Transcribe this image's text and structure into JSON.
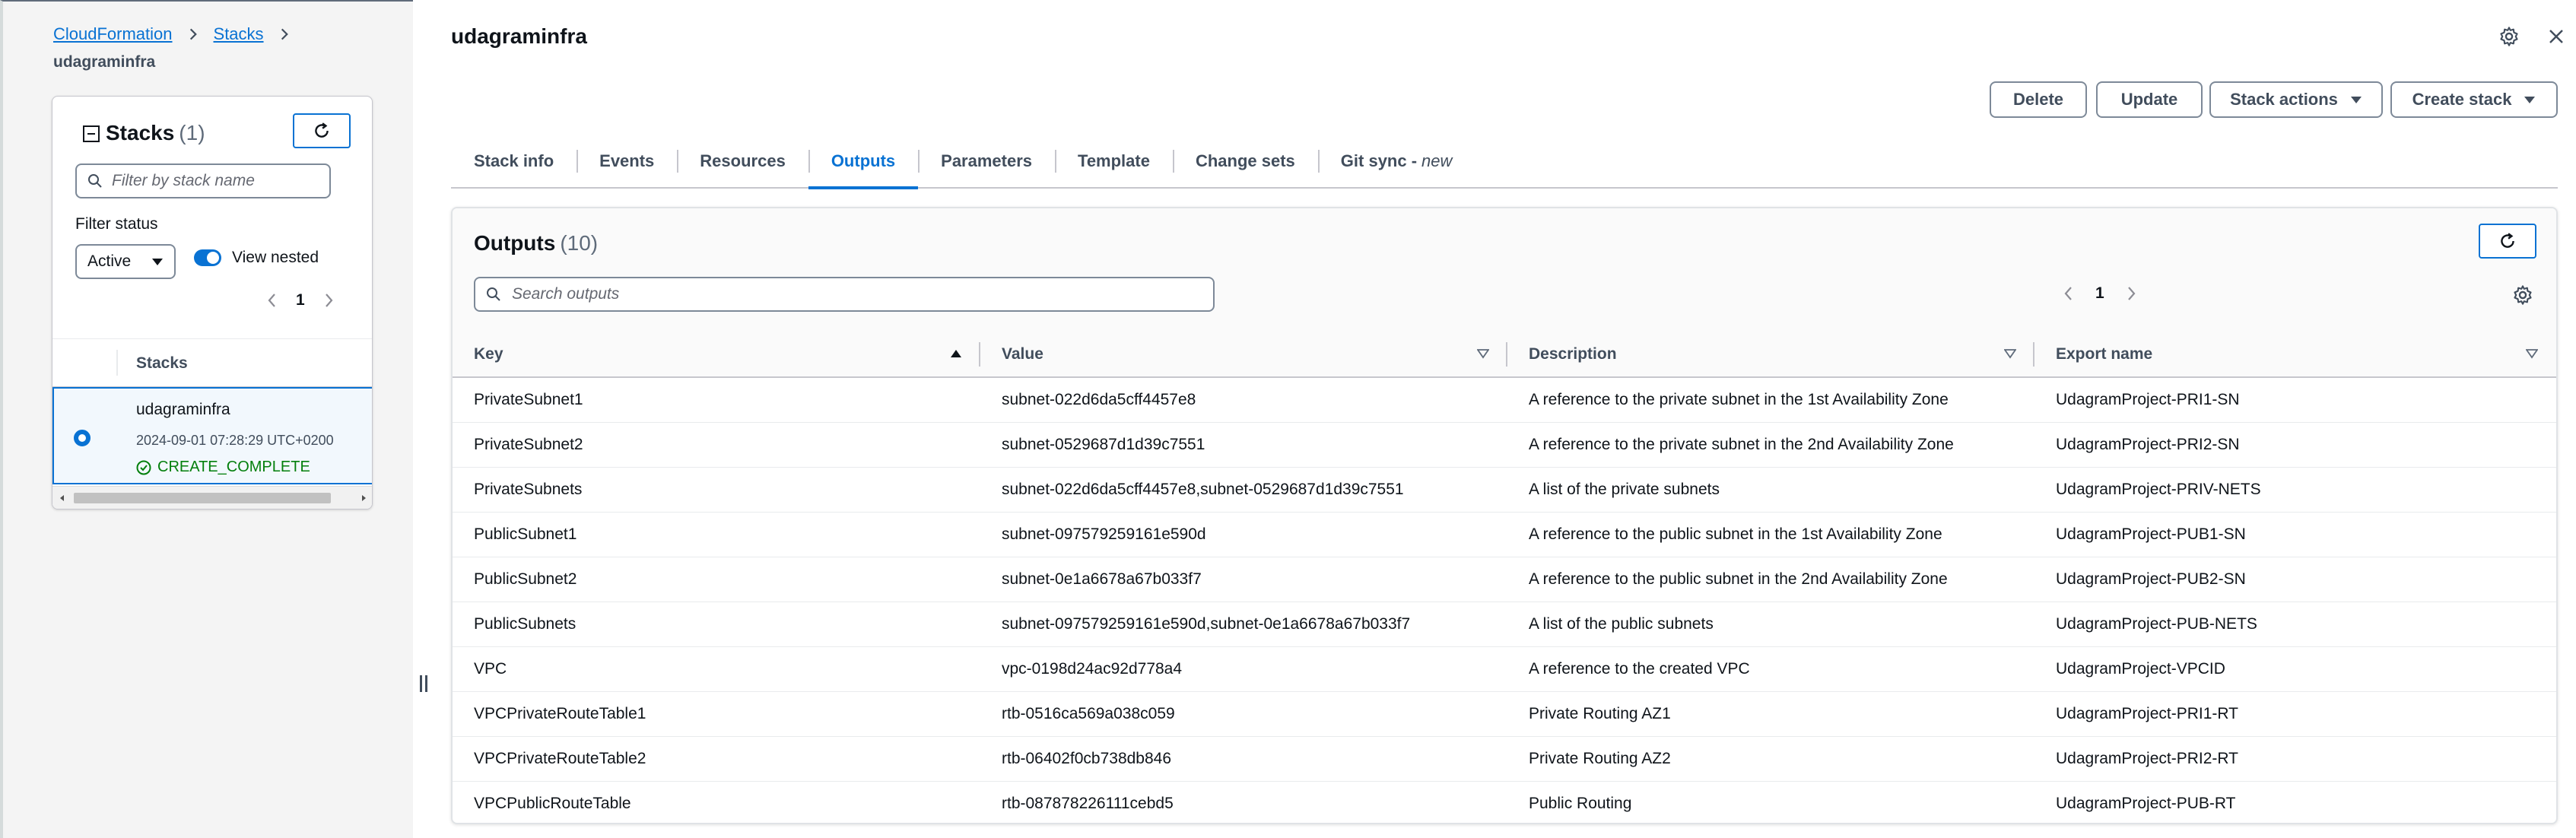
{
  "breadcrumb": {
    "items": [
      "CloudFormation",
      "Stacks"
    ],
    "current": "udagraminfra"
  },
  "stacks_panel": {
    "title": "Stacks",
    "count": "(1)",
    "filter_placeholder": "Filter by stack name",
    "filter_status_label": "Filter status",
    "status_value": "Active",
    "view_nested_label": "View nested",
    "page": "1",
    "column_header": "Stacks",
    "stack": {
      "name": "udagraminfra",
      "date": "2024-09-01 07:28:29 UTC+0200",
      "status": "CREATE_COMPLETE"
    }
  },
  "header": {
    "title": "udagraminfra",
    "buttons": {
      "delete": "Delete",
      "update": "Update",
      "stack_actions": "Stack actions",
      "create_stack": "Create stack"
    }
  },
  "tabs": [
    {
      "label": "Stack info"
    },
    {
      "label": "Events"
    },
    {
      "label": "Resources"
    },
    {
      "label": "Outputs",
      "active": true
    },
    {
      "label": "Parameters"
    },
    {
      "label": "Template"
    },
    {
      "label": "Change sets"
    },
    {
      "label": "Git sync - ",
      "suffix": "new"
    }
  ],
  "outputs": {
    "title": "Outputs",
    "count": "(10)",
    "search_placeholder": "Search outputs",
    "page": "1",
    "columns": [
      "Key",
      "Value",
      "Description",
      "Export name"
    ],
    "rows": [
      [
        "PrivateSubnet1",
        "subnet-022d6da5cff4457e8",
        "A reference to the private subnet in the 1st Availability Zone",
        "UdagramProject-PRI1-SN"
      ],
      [
        "PrivateSubnet2",
        "subnet-0529687d1d39c7551",
        "A reference to the private subnet in the 2nd Availability Zone",
        "UdagramProject-PRI2-SN"
      ],
      [
        "PrivateSubnets",
        "subnet-022d6da5cff4457e8,subnet-0529687d1d39c7551",
        "A list of the private subnets",
        "UdagramProject-PRIV-NETS"
      ],
      [
        "PublicSubnet1",
        "subnet-097579259161e590d",
        "A reference to the public subnet in the 1st Availability Zone",
        "UdagramProject-PUB1-SN"
      ],
      [
        "PublicSubnet2",
        "subnet-0e1a6678a67b033f7",
        "A reference to the public subnet in the 2nd Availability Zone",
        "UdagramProject-PUB2-SN"
      ],
      [
        "PublicSubnets",
        "subnet-097579259161e590d,subnet-0e1a6678a67b033f7",
        "A list of the public subnets",
        "UdagramProject-PUB-NETS"
      ],
      [
        "VPC",
        "vpc-0198d24ac92d778a4",
        "A reference to the created VPC",
        "UdagramProject-VPCID"
      ],
      [
        "VPCPrivateRouteTable1",
        "rtb-0516ca569a038c059",
        "Private Routing AZ1",
        "UdagramProject-PRI1-RT"
      ],
      [
        "VPCPrivateRouteTable2",
        "rtb-06402f0cb738db846",
        "Private Routing AZ2",
        "UdagramProject-PRI2-RT"
      ],
      [
        "VPCPublicRouteTable",
        "rtb-087878226111cebd5",
        "Public Routing",
        "UdagramProject-PUB-RT"
      ]
    ]
  },
  "colors": {
    "accent": "#0972d3",
    "success": "#037f0c",
    "panel_bg": "#f4f4f4"
  },
  "icons": [
    "chevron-right-icon",
    "collapse-icon",
    "refresh-icon",
    "search-icon",
    "caret-down-icon",
    "chevron-left-icon",
    "check-circle-icon",
    "settings-icon",
    "close-icon",
    "sort-ascending-icon",
    "sort-descending-icon"
  ]
}
